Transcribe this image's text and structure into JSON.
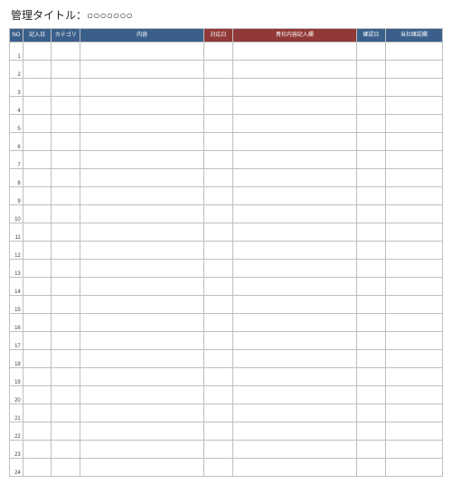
{
  "title": "管理タイトル：○○○○○○○",
  "headers": {
    "no": "NO",
    "entry_date": "記入日",
    "category": "カテゴリ",
    "content": "内容",
    "response_date": "対応日",
    "their_entry": "貴社内容記入欄",
    "ack_date": "確認日",
    "our_confirm": "当社確認欄"
  },
  "rows": [
    {
      "no": "1"
    },
    {
      "no": "2"
    },
    {
      "no": "3"
    },
    {
      "no": "4"
    },
    {
      "no": "5"
    },
    {
      "no": "6"
    },
    {
      "no": "7"
    },
    {
      "no": "8"
    },
    {
      "no": "9"
    },
    {
      "no": "10"
    },
    {
      "no": "11"
    },
    {
      "no": "12"
    },
    {
      "no": "13"
    },
    {
      "no": "14"
    },
    {
      "no": "15"
    },
    {
      "no": "16"
    },
    {
      "no": "17"
    },
    {
      "no": "18"
    },
    {
      "no": "19"
    },
    {
      "no": "20"
    },
    {
      "no": "21"
    },
    {
      "no": "22"
    },
    {
      "no": "23"
    },
    {
      "no": "24"
    }
  ]
}
